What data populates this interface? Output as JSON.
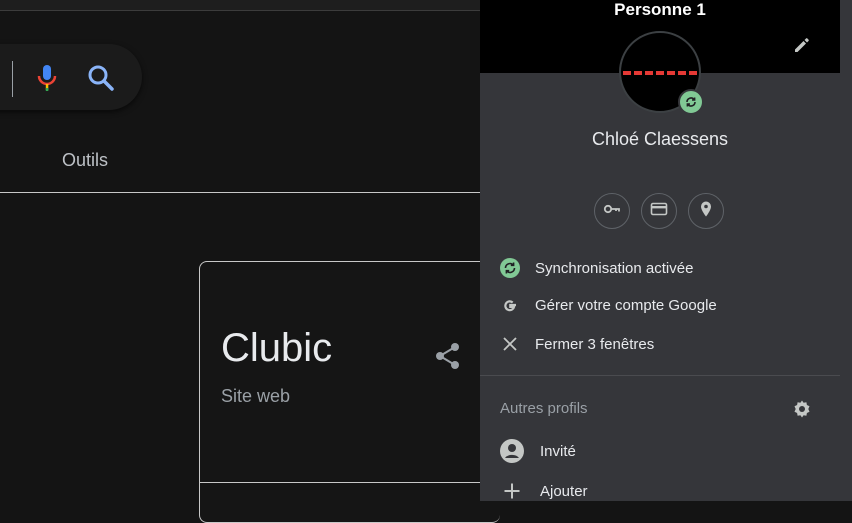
{
  "search": {
    "tools_label": "Outils"
  },
  "result_card": {
    "title": "Clubic",
    "subtitle": "Site web"
  },
  "profile_panel": {
    "profile_name": "Personne 1",
    "user_name": "Chloé Claessens",
    "shortcuts": [
      "key-icon",
      "credit-card-icon",
      "location-pin-icon"
    ],
    "items": [
      {
        "label": "Synchronisation activée",
        "icon": "sync-icon"
      },
      {
        "label": "Gérer votre compte Google",
        "icon": "google-g-icon"
      },
      {
        "label": "Fermer 3 fenêtres",
        "icon": "close-icon"
      }
    ],
    "other_profiles_label": "Autres profils",
    "other_profiles": [
      {
        "label": "Invité",
        "icon": "guest-avatar-icon"
      },
      {
        "label": "Ajouter",
        "icon": "plus-icon"
      }
    ]
  },
  "colors": {
    "panel_bg": "#35363a",
    "sync_green": "#81c995",
    "page_bg": "#141414"
  }
}
